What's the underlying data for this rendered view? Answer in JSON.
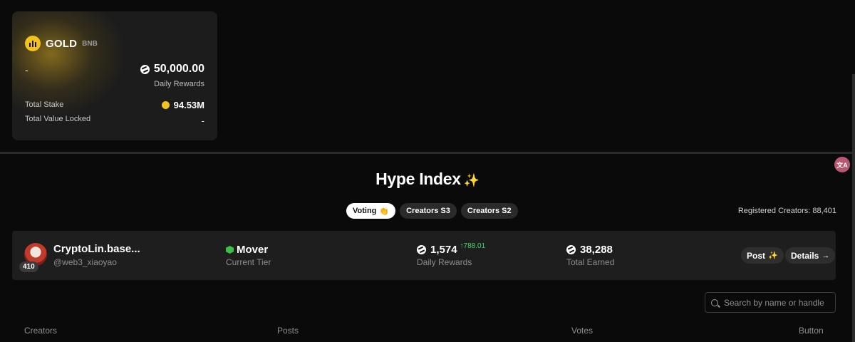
{
  "pool": {
    "name": "GOLD",
    "chain": "BNB",
    "left_value": "-",
    "daily_rewards": "50,000.00",
    "daily_rewards_label": "Daily Rewards",
    "total_stake_label": "Total Stake",
    "total_stake": "94.53M",
    "tvl_label": "Total Value Locked",
    "tvl": "-"
  },
  "translate_label": "文A",
  "hype": {
    "title": "Hype Index",
    "spark": "✨"
  },
  "tabs": [
    {
      "label": "Voting",
      "icon": "👏",
      "active": true
    },
    {
      "label": "Creators S3",
      "active": false
    },
    {
      "label": "Creators S2",
      "active": false
    }
  ],
  "registered_creators": "Registered Creators: 88,401",
  "user": {
    "rank": "410",
    "name": "CryptoLin.base...",
    "handle": "@web3_xiaoyao",
    "tier": "Mover",
    "tier_label": "Current Tier",
    "daily_rewards": "1,574",
    "daily_delta": "↑788.01",
    "daily_rewards_label": "Daily Rewards",
    "total_earned": "38,288",
    "total_earned_label": "Total Earned",
    "post_label": "Post",
    "details_label": "Details",
    "details_arrow": "→"
  },
  "search": {
    "placeholder": "Search by name or handle"
  },
  "columns": [
    "Creators",
    "Posts",
    "Votes",
    "Button"
  ]
}
